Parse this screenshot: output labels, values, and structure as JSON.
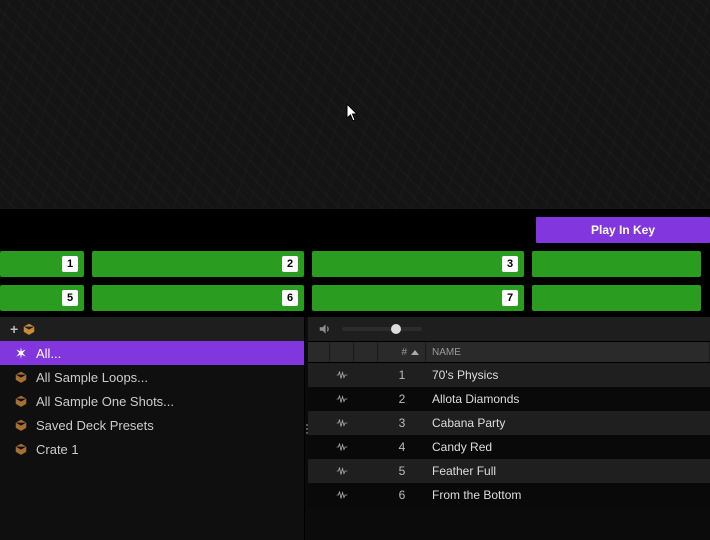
{
  "play_in_key_label": "Play In Key",
  "pads_row1": [
    "1",
    "2",
    "3",
    ""
  ],
  "pads_row2": [
    "5",
    "6",
    "7",
    ""
  ],
  "sidebar": {
    "items": [
      {
        "label": "All...",
        "icon": "asterisk",
        "selected": true
      },
      {
        "label": "All Sample Loops...",
        "icon": "crate",
        "selected": false
      },
      {
        "label": "All Sample One Shots...",
        "icon": "crate",
        "selected": false
      },
      {
        "label": "Saved Deck Presets",
        "icon": "crate",
        "selected": false
      },
      {
        "label": "Crate 1",
        "icon": "crate",
        "selected": false
      }
    ]
  },
  "volume_value": "70",
  "table": {
    "columns": {
      "index": "#",
      "name": "NAME"
    },
    "rows": [
      {
        "n": "1",
        "name": "70's Physics"
      },
      {
        "n": "2",
        "name": "Allota Diamonds"
      },
      {
        "n": "3",
        "name": "Cabana Party"
      },
      {
        "n": "4",
        "name": "Candy Red"
      },
      {
        "n": "5",
        "name": "Feather Full"
      },
      {
        "n": "6",
        "name": "From the Bottom"
      }
    ]
  }
}
